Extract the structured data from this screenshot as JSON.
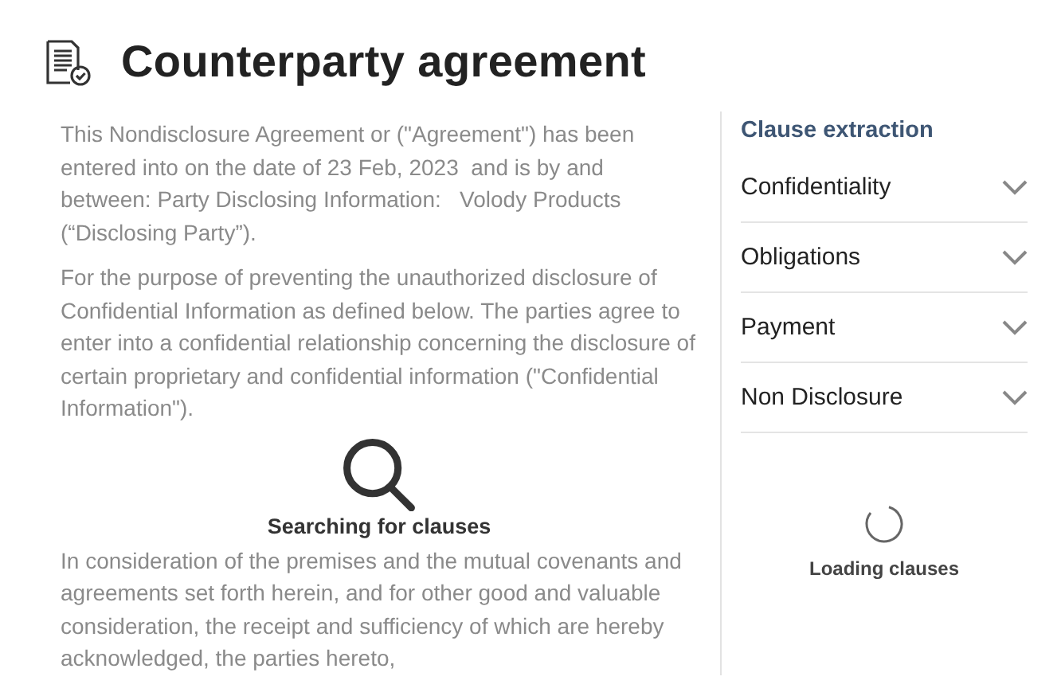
{
  "header": {
    "title": "Counterparty agreement"
  },
  "document": {
    "paragraphs": [
      "This Nondisclosure Agreement or (\"Agreement\") has been entered into on the date of 23 Feb, 2023  and is by and between: Party Disclosing Information:   Volody Products (“Disclosing Party”).",
      "For the purpose of preventing the unauthorized disclosure of Confidential Information as defined below. The parties agree to enter into a confidential relationship concerning the disclosure of certain proprietary and confidential information (\"Confidential Information\").",
      "In consideration of the premises and the mutual covenants and agreements set forth herein, and for other good and valuable consideration, the receipt and sufficiency of which are hereby acknowledged, the parties hereto,"
    ]
  },
  "search_overlay": {
    "label": "Searching for clauses"
  },
  "clause_panel": {
    "title": "Clause extraction",
    "clauses": [
      {
        "label": "Confidentiality",
        "expanded": false
      },
      {
        "label": "Obligations",
        "expanded": false
      },
      {
        "label": "Payment",
        "expanded": false
      },
      {
        "label": "Non Disclosure",
        "expanded": false
      }
    ],
    "loading": {
      "label": "Loading clauses"
    }
  }
}
